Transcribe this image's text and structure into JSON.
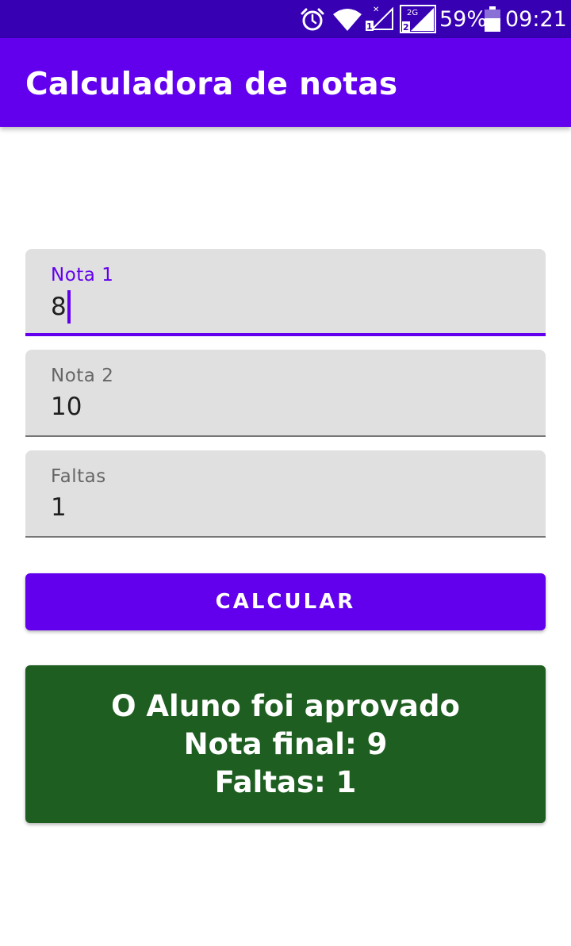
{
  "status_bar": {
    "battery_percent": "59%",
    "time": "09:21",
    "network_label": "2G",
    "sim1_label": "1",
    "sim2_label": "2",
    "icons": [
      "alarm-icon",
      "wifi-icon",
      "signal-sim1-icon",
      "signal-sim2-icon",
      "battery-icon"
    ]
  },
  "app_bar": {
    "title": "Calculadora de notas",
    "color": "#6200ee"
  },
  "form": {
    "nota1": {
      "label": "Nota 1",
      "value": "8",
      "focused": true
    },
    "nota2": {
      "label": "Nota 2",
      "value": "10"
    },
    "faltas": {
      "label": "Faltas",
      "value": "1"
    }
  },
  "button": {
    "label": "CALCULAR",
    "color": "#6200ee"
  },
  "result": {
    "line1": "O Aluno foi aprovado",
    "line2": "Nota final: 9",
    "line3": "Faltas: 1",
    "color": "#1e5e20"
  }
}
